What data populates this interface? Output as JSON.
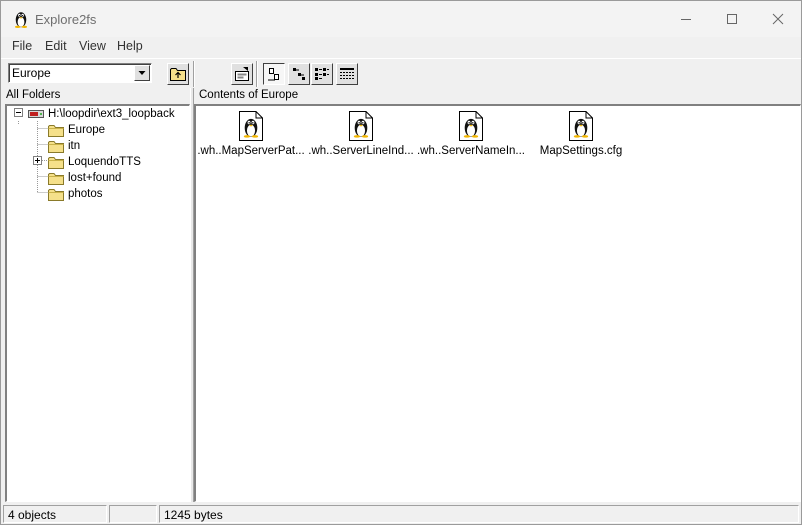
{
  "window": {
    "title": "Explore2fs"
  },
  "menu": [
    "File",
    "Edit",
    "View",
    "Help"
  ],
  "toolbar": {
    "location_value": "Europe",
    "buttons": [
      "up-folder-icon",
      "properties-icon",
      "large-icons-view-icon",
      "small-icons-view-icon",
      "list-view-icon",
      "details-view-icon"
    ]
  },
  "left_pane": {
    "header": "All Folders",
    "root": "H:\\loopdir\\ext3_loopback",
    "folders": [
      "Europe",
      "itn",
      "LoquendoTTS",
      "lost+found",
      "photos"
    ]
  },
  "right_pane": {
    "header": "Contents of Europe",
    "files": [
      ".wh..MapServerPat...",
      ".wh..ServerLineInd...",
      ".wh..ServerNameIn...",
      "MapSettings.cfg"
    ]
  },
  "status": {
    "objects": "4 objects",
    "middle": "",
    "size": "1245 bytes"
  },
  "colors": {
    "folder": "#f5e08a",
    "window_bg": "#f0f0f0",
    "pane_bg": "#ffffff"
  }
}
